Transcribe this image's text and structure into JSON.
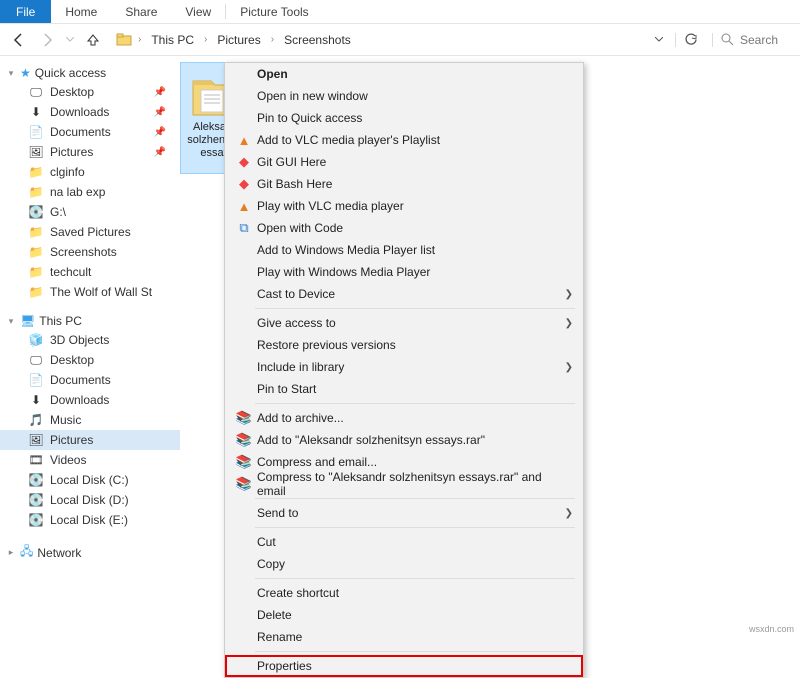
{
  "ribbon": {
    "file": "File",
    "home": "Home",
    "share": "Share",
    "view": "View",
    "picture_tools": "Picture Tools"
  },
  "nav": {
    "this_pc": "This PC",
    "pictures": "Pictures",
    "screenshots": "Screenshots",
    "search": "Search"
  },
  "sidebar": {
    "quick_access": "Quick access",
    "qa_items": [
      {
        "label": "Desktop",
        "pinned": true,
        "icon": "desktop"
      },
      {
        "label": "Downloads",
        "pinned": true,
        "icon": "downloads"
      },
      {
        "label": "Documents",
        "pinned": true,
        "icon": "documents"
      },
      {
        "label": "Pictures",
        "pinned": true,
        "icon": "pictures"
      },
      {
        "label": "clginfo",
        "pinned": false,
        "icon": "folder"
      },
      {
        "label": "na lab exp",
        "pinned": false,
        "icon": "folder"
      },
      {
        "label": "G:\\",
        "pinned": false,
        "icon": "drive"
      },
      {
        "label": "Saved Pictures",
        "pinned": false,
        "icon": "folder"
      },
      {
        "label": "Screenshots",
        "pinned": false,
        "icon": "folder"
      },
      {
        "label": "techcult",
        "pinned": false,
        "icon": "folder"
      },
      {
        "label": "The Wolf of Wall St",
        "pinned": false,
        "icon": "folder"
      }
    ],
    "this_pc": "This PC",
    "pc_items": [
      {
        "label": "3D Objects",
        "icon": "3d"
      },
      {
        "label": "Desktop",
        "icon": "desktop"
      },
      {
        "label": "Documents",
        "icon": "documents"
      },
      {
        "label": "Downloads",
        "icon": "downloads"
      },
      {
        "label": "Music",
        "icon": "music"
      },
      {
        "label": "Pictures",
        "icon": "pictures",
        "selected": true
      },
      {
        "label": "Videos",
        "icon": "videos"
      },
      {
        "label": "Local Disk (C:)",
        "icon": "drive"
      },
      {
        "label": "Local Disk (D:)",
        "icon": "drive"
      },
      {
        "label": "Local Disk (E:)",
        "icon": "drive"
      }
    ],
    "network": "Network"
  },
  "content": {
    "folder_name": "Aleksandr solzhenitsyn essays"
  },
  "context_menu": {
    "open": "Open",
    "open_new_window": "Open in new window",
    "pin_qa": "Pin to Quick access",
    "vlc_playlist": "Add to VLC media player's Playlist",
    "git_gui": "Git GUI Here",
    "git_bash": "Git Bash Here",
    "vlc_play": "Play with VLC media player",
    "open_code": "Open with Code",
    "wmp_list": "Add to Windows Media Player list",
    "wmp_play": "Play with Windows Media Player",
    "cast": "Cast to Device",
    "give_access": "Give access to",
    "restore_prev": "Restore previous versions",
    "include_lib": "Include in library",
    "pin_start": "Pin to Start",
    "add_archive": "Add to archive...",
    "add_rar": "Add to \"Aleksandr solzhenitsyn essays.rar\"",
    "compress_email": "Compress and email...",
    "compress_rar_email": "Compress to \"Aleksandr solzhenitsyn essays.rar\" and email",
    "send_to": "Send to",
    "cut": "Cut",
    "copy": "Copy",
    "create_shortcut": "Create shortcut",
    "delete": "Delete",
    "rename": "Rename",
    "properties": "Properties"
  },
  "watermark": "wsxdn.com"
}
